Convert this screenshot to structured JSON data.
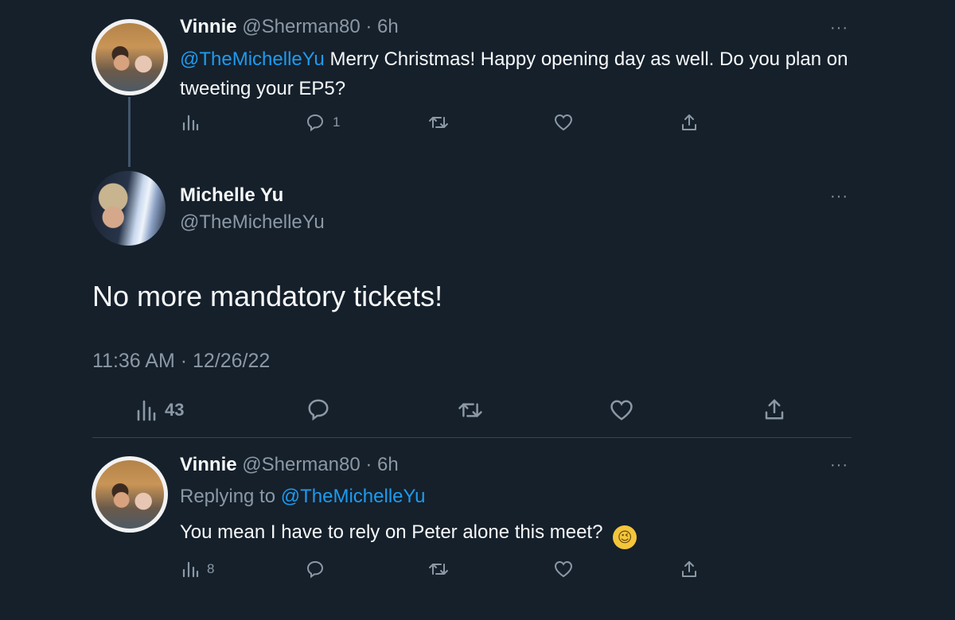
{
  "tweet1": {
    "name": "Vinnie",
    "handle": "@Sherman80",
    "dot": "·",
    "time": "6h",
    "mention": "@TheMichelleYu",
    "text": "Merry Christmas!  Happy opening day as well. Do you plan on tweeting your EP5?",
    "reply_count": "1",
    "more": "···"
  },
  "main_tweet": {
    "name": "Michelle Yu",
    "handle": "@TheMichelleYu",
    "text": "No more mandatory tickets!",
    "timestamp": "11:36 AM · 12/26/22",
    "views": "43",
    "more": "···"
  },
  "reply": {
    "name": "Vinnie",
    "handle": "@Sherman80",
    "dot": "·",
    "time": "6h",
    "replying_to_label": "Replying to",
    "replying_to_handle": "@TheMichelleYu",
    "text": "You mean I have to rely on Peter alone this meet?",
    "emoji": "😉",
    "views": "8",
    "more": "···"
  },
  "colors": {
    "background": "#15202b",
    "link": "#1d9bf0",
    "muted": "#8b98a5"
  },
  "icons": [
    "analytics-icon",
    "reply-icon",
    "retweet-icon",
    "like-icon",
    "share-icon",
    "more-icon"
  ]
}
